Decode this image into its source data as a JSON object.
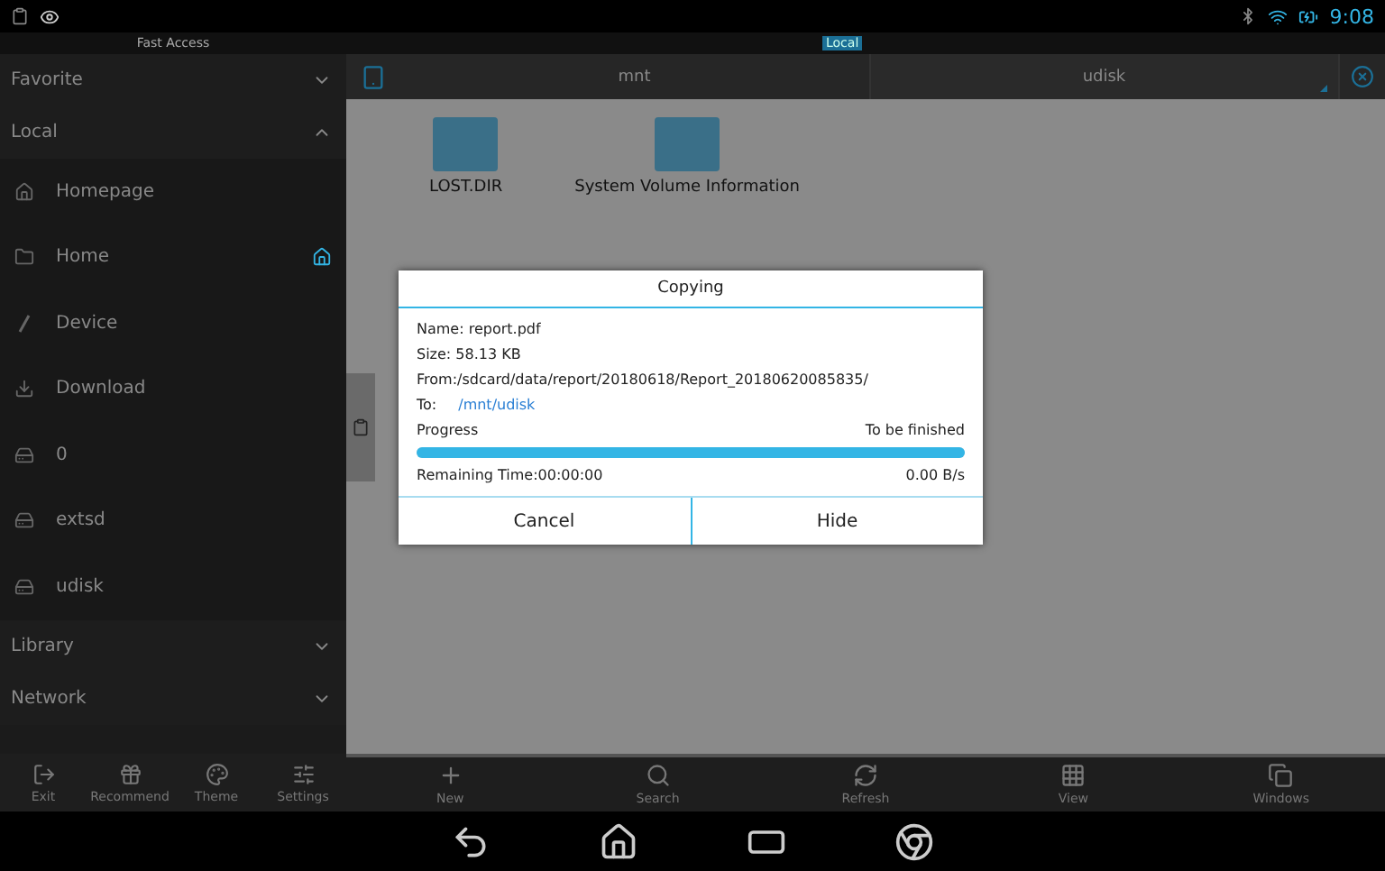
{
  "status_bar": {
    "time": "9:08"
  },
  "access_bar": {
    "title": "Fast Access",
    "location": "Local"
  },
  "sidebar": {
    "sections": [
      {
        "label": "Favorite",
        "expanded": false
      },
      {
        "label": "Local",
        "expanded": true,
        "items": [
          {
            "kind": "homepage",
            "label": "Homepage",
            "default": false
          },
          {
            "kind": "folder",
            "label": "Home",
            "default": true
          },
          {
            "kind": "root",
            "label": "Device",
            "default": false
          },
          {
            "kind": "download",
            "label": "Download",
            "default": false
          },
          {
            "kind": "storage",
            "label": "0",
            "default": false
          },
          {
            "kind": "storage",
            "label": "extsd",
            "default": false
          },
          {
            "kind": "storage",
            "label": "udisk",
            "default": false
          }
        ]
      },
      {
        "label": "Library",
        "expanded": false
      },
      {
        "label": "Network",
        "expanded": false
      }
    ]
  },
  "path_tabs": [
    {
      "label": "mnt",
      "selected": false
    },
    {
      "label": "udisk",
      "selected": true
    }
  ],
  "files": [
    {
      "name": "LOST.DIR"
    },
    {
      "name": "System Volume Information"
    }
  ],
  "dialog": {
    "title": "Copying",
    "name": "Name: report.pdf",
    "size": "Size: 58.13 KB",
    "from": "From:/sdcard/data/report/20180618/Report_20180620085835/",
    "to_label": "To:",
    "to_path": "/mnt/udisk",
    "progress_label": "Progress",
    "status": "To be finished",
    "level": 1,
    "remaining": "Remaining Time:00:00:00",
    "speed": "0.00 B/s",
    "buttons": [
      "Cancel",
      "Hide"
    ]
  },
  "left_toolbar": [
    {
      "kind": "exit",
      "label": "Exit"
    },
    {
      "kind": "gift",
      "label": "Recommend"
    },
    {
      "kind": "palette",
      "label": "Theme"
    },
    {
      "kind": "sliders",
      "label": "Settings"
    }
  ],
  "main_toolbar": [
    {
      "kind": "plus",
      "label": "New"
    },
    {
      "kind": "search",
      "label": "Search"
    },
    {
      "kind": "refresh",
      "label": "Refresh"
    },
    {
      "kind": "grid",
      "label": "View"
    },
    {
      "kind": "windows",
      "label": "Windows"
    }
  ]
}
